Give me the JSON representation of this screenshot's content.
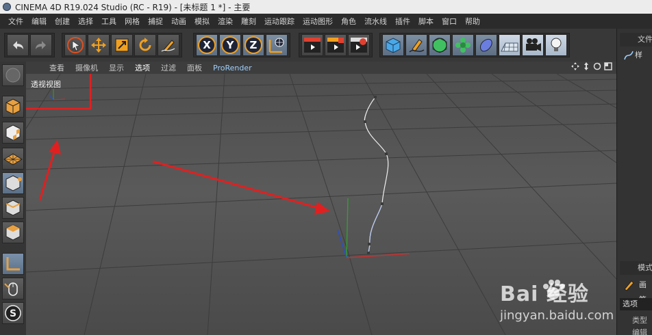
{
  "window": {
    "title": "CINEMA 4D R19.024 Studio (RC - R19) - [未标题 1 *] - 主要"
  },
  "menu": [
    "文件",
    "编辑",
    "创建",
    "选择",
    "工具",
    "网格",
    "捕捉",
    "动画",
    "模拟",
    "渲染",
    "雕刻",
    "运动跟踪",
    "运动图形",
    "角色",
    "流水线",
    "插件",
    "脚本",
    "窗口",
    "帮助"
  ],
  "toolbar": {
    "icons": [
      "undo-icon",
      "redo-icon",
      "live-select-icon",
      "move-icon",
      "scale-icon",
      "rotate-icon",
      "sketch-icon",
      "x-axis-icon",
      "y-axis-icon",
      "z-axis-icon",
      "world-coordinate-icon",
      "render-view-icon",
      "render-picture-viewer-icon",
      "render-settings-icon",
      "cube-icon",
      "pen-spline-icon",
      "subdivision-icon",
      "cloner-icon",
      "deformer-icon",
      "floor-icon",
      "camera-icon",
      "light-icon"
    ]
  },
  "viewport_menu": {
    "items": [
      "查看",
      "摄像机",
      "显示",
      "选项",
      "过滤",
      "面板",
      "ProRender"
    ],
    "active": "选项"
  },
  "viewport": {
    "label": "透视视图"
  },
  "right_panel": {
    "objects_tab": "文件",
    "object_row": "样",
    "mode_tab": "模式",
    "brush_label": "画笔",
    "options_tab": "选项",
    "type_label": "类型",
    "edit_label": "编辑"
  },
  "watermark": {
    "logo": "Bai 经验",
    "url": "jingyan.baidu.com"
  },
  "colors": {
    "annotation_red": "#e02020",
    "axis_x": "#c83030",
    "axis_y": "#2fa030",
    "axis_z": "#2850c8",
    "spline_white": "#f0f0f0",
    "spline_blue": "#b9c8f0"
  }
}
